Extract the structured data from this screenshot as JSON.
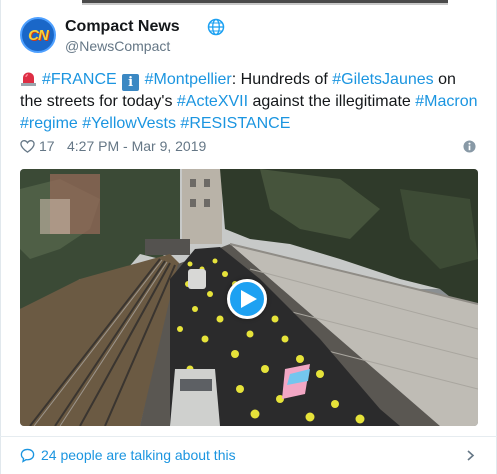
{
  "author": {
    "name": "Compact News",
    "handle": "@NewsCompact",
    "avatar_initials": "CN",
    "verified_icon": "globe-icon"
  },
  "tweet": {
    "parts": [
      {
        "type": "emoji",
        "icon": "police-light-icon"
      },
      {
        "type": "tag",
        "text": "#FRANCE"
      },
      {
        "type": "text",
        "text": " "
      },
      {
        "type": "emoji",
        "icon": "information-icon",
        "text": "i"
      },
      {
        "type": "text",
        "text": " "
      },
      {
        "type": "tag",
        "text": "#Montpellier"
      },
      {
        "type": "text",
        "text": ": Hundreds of "
      },
      {
        "type": "tag",
        "text": "#GiletsJaunes"
      },
      {
        "type": "text",
        "text": " on the streets for today's "
      },
      {
        "type": "tag",
        "text": "#ActeXVII"
      },
      {
        "type": "text",
        "text": " against the illegitimate "
      },
      {
        "type": "tag",
        "text": "#Macron"
      },
      {
        "type": "text",
        "text": " "
      },
      {
        "type": "tag",
        "text": "#regime"
      },
      {
        "type": "text",
        "text": " "
      },
      {
        "type": "tag",
        "text": "#YellowVests"
      },
      {
        "type": "text",
        "text": " "
      },
      {
        "type": "tag",
        "text": "#RESISTANCE"
      }
    ]
  },
  "meta": {
    "likes": "17",
    "timestamp": "4:27 PM - Mar 9, 2019",
    "heart_icon": "heart-icon",
    "info_icon": "info-circle-icon"
  },
  "media": {
    "type": "video",
    "play_icon": "play-icon"
  },
  "footer": {
    "talking": "24 people are talking about this",
    "bubble_icon": "speech-bubble-icon",
    "chevron_icon": "chevron-right-icon"
  },
  "colors": {
    "link": "#1b95e0",
    "secondary": "#657786",
    "play": "#1da1f2",
    "text": "#14171a"
  }
}
